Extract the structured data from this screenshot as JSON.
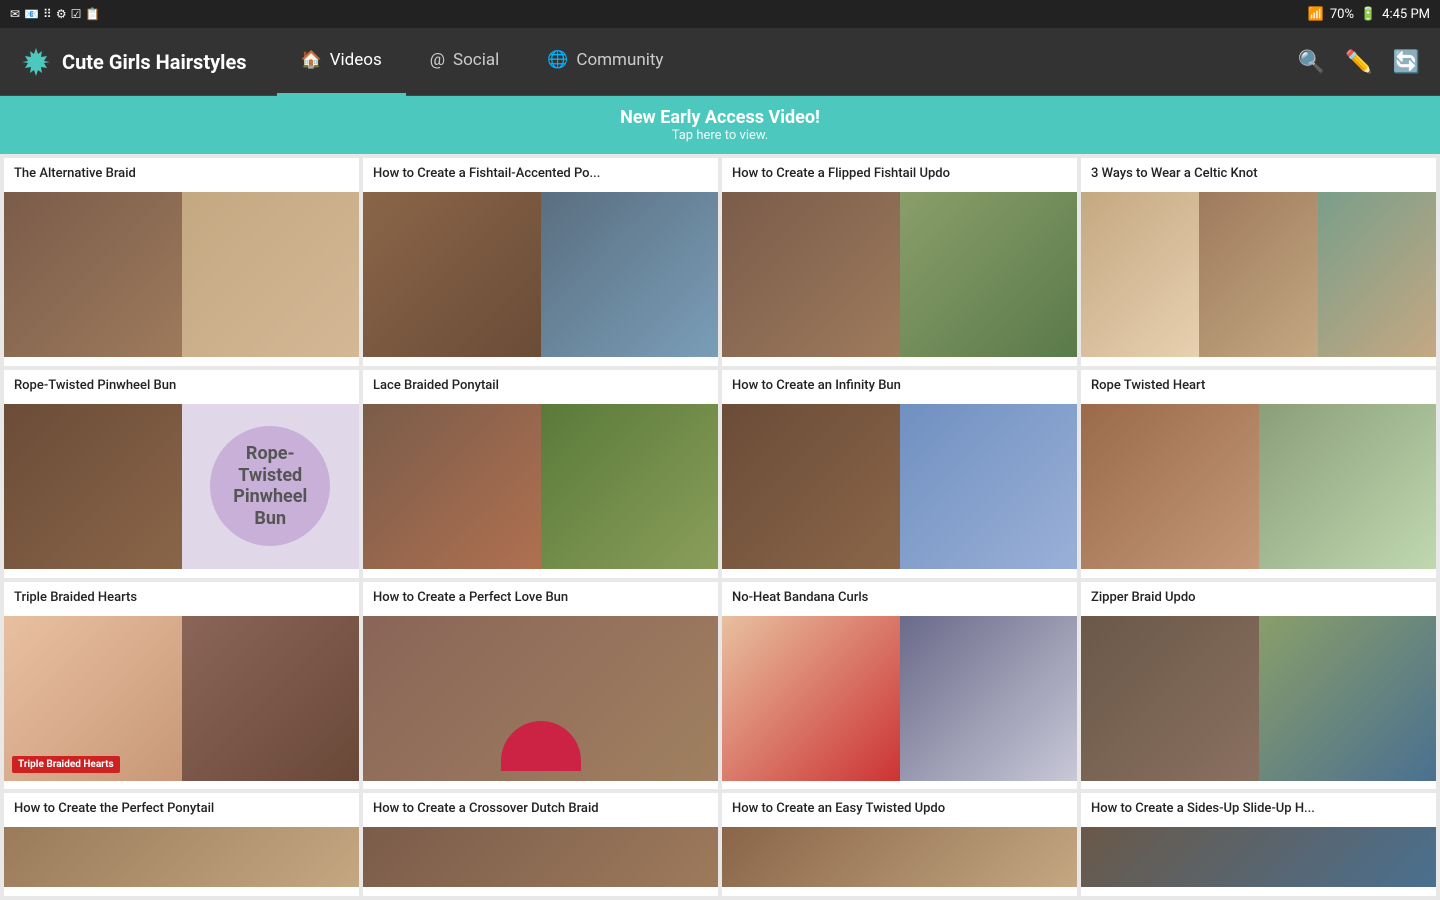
{
  "statusBar": {
    "time": "4:45 PM",
    "battery": "70%",
    "icons": [
      "msg",
      "email",
      "drag",
      "settings",
      "task",
      "clipboard"
    ]
  },
  "nav": {
    "brand": "Cute Girls Hairstyles",
    "tabs": [
      {
        "id": "videos",
        "label": "Videos",
        "active": true,
        "icon": "home"
      },
      {
        "id": "social",
        "label": "Social",
        "active": false,
        "icon": "at"
      },
      {
        "id": "community",
        "label": "Community",
        "active": false,
        "icon": "globe"
      }
    ],
    "actions": [
      "search",
      "edit",
      "refresh"
    ]
  },
  "banner": {
    "title": "New Early Access Video!",
    "subtitle": "Tap here to view."
  },
  "videos": [
    {
      "id": 1,
      "title": "The Alternative Braid",
      "thumbType": "double"
    },
    {
      "id": 2,
      "title": "How to Create a Fishtail-Accented Po...",
      "thumbType": "double"
    },
    {
      "id": 3,
      "title": "How to Create a Flipped Fishtail Updo",
      "thumbType": "double"
    },
    {
      "id": 4,
      "title": "3 Ways to Wear a Celtic Knot",
      "thumbType": "triple"
    },
    {
      "id": 5,
      "title": "Rope-Twisted Pinwheel Bun",
      "thumbType": "text-overlay"
    },
    {
      "id": 6,
      "title": "Lace Braided Ponytail",
      "thumbType": "double"
    },
    {
      "id": 7,
      "title": "How to Create an Infinity Bun",
      "thumbType": "double"
    },
    {
      "id": 8,
      "title": "Rope Twisted Heart",
      "thumbType": "double"
    },
    {
      "id": 9,
      "title": "Triple Braided Hearts",
      "thumbType": "label-overlay"
    },
    {
      "id": 10,
      "title": "How to Create a Perfect Love Bun",
      "thumbType": "single"
    },
    {
      "id": 11,
      "title": "No-Heat Bandana Curls",
      "thumbType": "double"
    },
    {
      "id": 12,
      "title": "Zipper Braid Updo",
      "thumbType": "double"
    },
    {
      "id": 13,
      "title": "How to Create the Perfect Ponytail",
      "thumbType": "partial"
    },
    {
      "id": 14,
      "title": "How to Create a Crossover Dutch Braid",
      "thumbType": "partial"
    },
    {
      "id": 15,
      "title": "How to Create an Easy Twisted Updo",
      "thumbType": "partial"
    },
    {
      "id": 16,
      "title": "How to Create a Sides-Up Slide-Up H...",
      "thumbType": "partial"
    }
  ]
}
